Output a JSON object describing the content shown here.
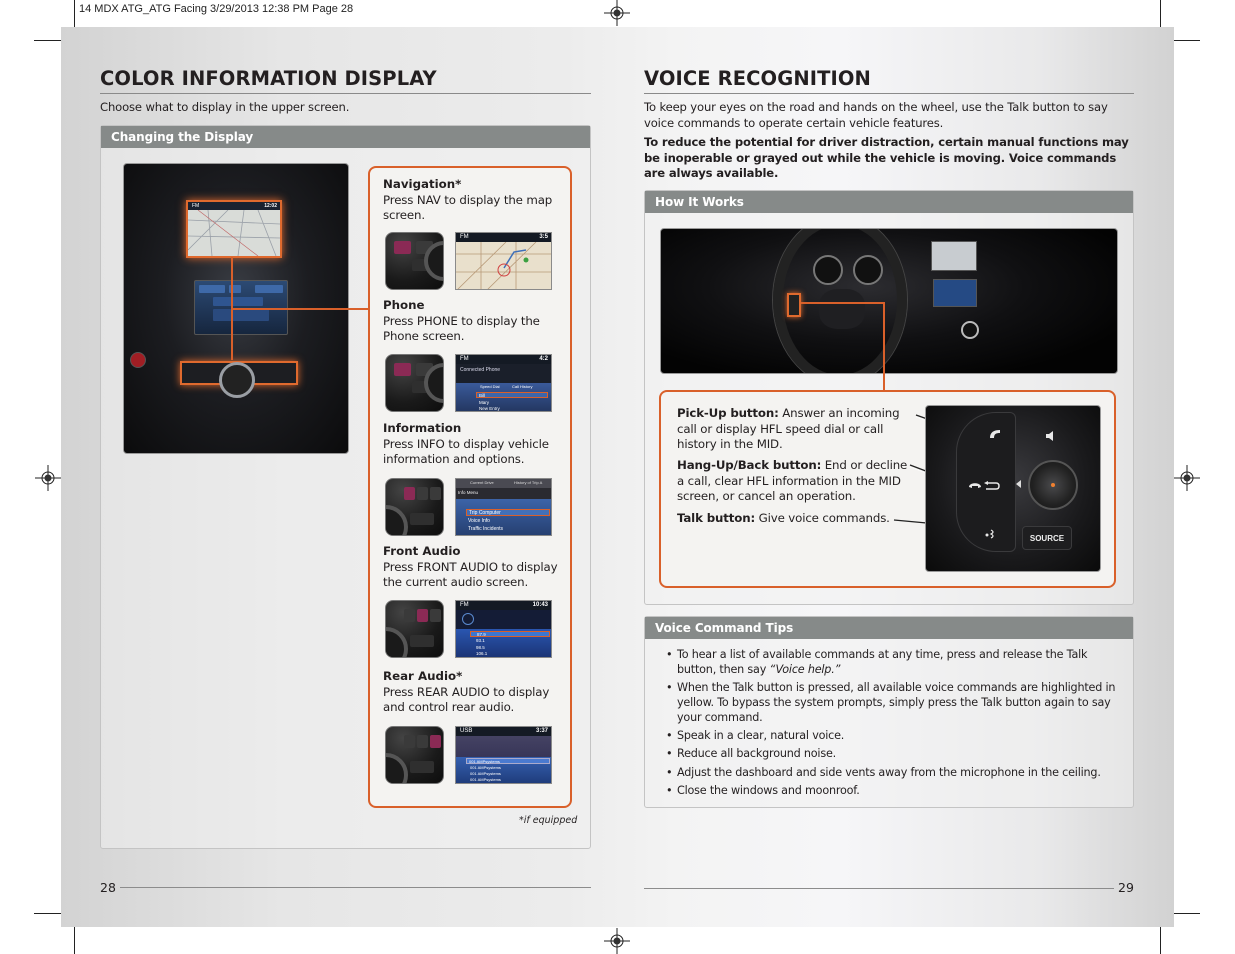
{
  "slug": "14 MDX ATG_ATG Facing  3/29/2013  12:38 PM  Page 28",
  "left_page": {
    "heading": "COLOR INFORMATION DISPLAY",
    "intro": "Choose what to display in the upper screen.",
    "section_bar": "Changing the Display",
    "console_photo": {
      "screen_clock": "12:02",
      "screen_band": "FM"
    },
    "features": [
      {
        "title": "Navigation*",
        "description": "Press NAV to display the map screen.",
        "screen": {
          "band": "FM",
          "clock": "3:5",
          "kind": "map"
        }
      },
      {
        "title": "Phone",
        "description": "Press PHONE to display the Phone screen.",
        "screen": {
          "band": "FM",
          "clock": "4:2",
          "kind": "phone",
          "heading": "Connected Phone",
          "tabs": [
            "Speed Dial",
            "Call History"
          ],
          "rows": [
            "Bill",
            "Mary",
            "New Entry"
          ]
        }
      },
      {
        "title": "Information",
        "description": "Press INFO to display vehicle information and options.",
        "screen": {
          "kind": "info",
          "tabs": [
            "Current Drive",
            "History of Trip A"
          ],
          "heading": "Info Menu",
          "rows": [
            "Trip Computer",
            "Voice Info",
            "Traffic Incidents"
          ]
        }
      },
      {
        "title": "Front Audio",
        "description": "Press FRONT AUDIO to display the current audio screen.",
        "screen": {
          "band": "FM",
          "clock": "10:43",
          "kind": "audio",
          "rows": [
            "87.9",
            "93.1",
            "98.5",
            "106.1"
          ]
        }
      },
      {
        "title": "Rear Audio*",
        "description": "Press REAR AUDIO to display and control rear audio.",
        "screen": {
          "band": "USB",
          "clock": "3:37",
          "kind": "rear-audio",
          "rows": [
            "001 AMPsystems",
            "001 AMPsystems",
            "001 AMPsystems",
            "001 AMPsystems"
          ]
        }
      }
    ],
    "footnote": "*if equipped",
    "page_number": "28"
  },
  "right_page": {
    "heading": "VOICE RECOGNITION",
    "intro": "To keep your eyes on the road and hands on the wheel, use the Talk button to say voice commands to operate certain vehicle features.",
    "warning": "To reduce the potential for driver distraction, certain manual functions may be inoperable or grayed out while the vehicle is moving. Voice commands are always available.",
    "how_it_works": {
      "bar": "How It Works",
      "buttons": [
        {
          "label": "Pick-Up button:",
          "text": " Answer an incoming call or display HFL speed dial or call history in the MID."
        },
        {
          "label": "Hang-Up/Back button:",
          "text": " End or decline a call, clear HFL information in the MID screen, or cancel an operation."
        },
        {
          "label": "Talk button:",
          "text": " Give voice commands."
        }
      ],
      "wheel_source_label": "SOURCE"
    },
    "tips": {
      "bar": "Voice Command Tips",
      "items": [
        {
          "text": "To hear a list of available commands at any time, press and release the Talk button, then say ",
          "quote": "“Voice help.”"
        },
        {
          "text": "When the Talk button is pressed, all available voice commands are highlighted in yellow. To bypass the system prompts, simply press the Talk button again to say your command."
        },
        {
          "text": "Speak in a clear, natural voice."
        },
        {
          "text": "Reduce all background noise."
        },
        {
          "text": "Adjust the dashboard and side vents away from the microphone in the ceiling."
        },
        {
          "text": "Close the windows and moonroof."
        }
      ]
    },
    "page_number": "29"
  },
  "colors": {
    "accent_orange": "#d9602a",
    "section_bar_gray": "#868a89",
    "highlight_magenta": "#8b2a55"
  }
}
